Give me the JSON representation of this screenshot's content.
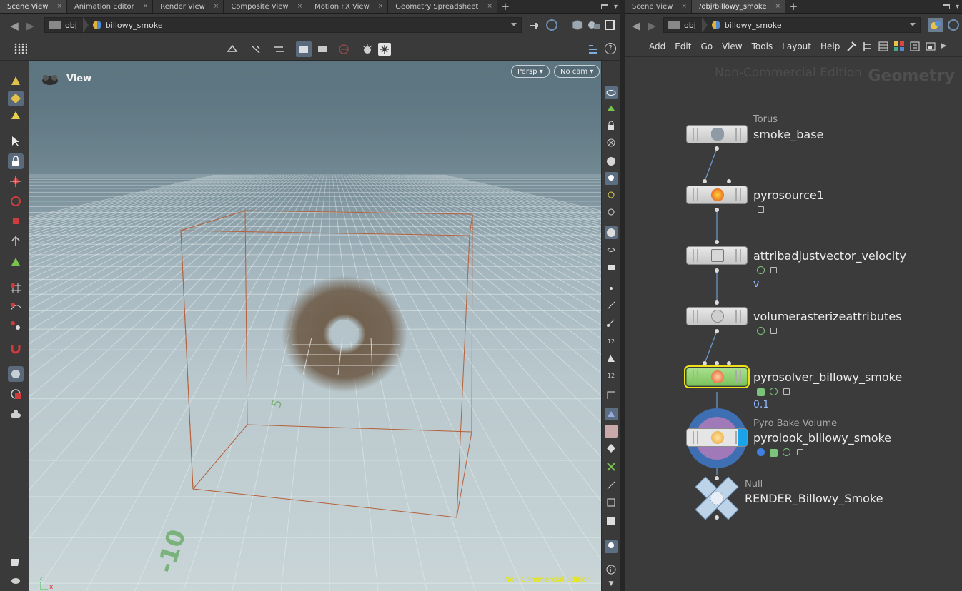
{
  "left_tabs": [
    "Scene View",
    "Animation Editor",
    "Render View",
    "Composite View",
    "Motion FX View",
    "Geometry Spreadsheet"
  ],
  "right_tabs": [
    "Scene View",
    "/obj/billowy_smoke"
  ],
  "left_path": {
    "root": "obj",
    "node": "billowy_smoke"
  },
  "right_path": {
    "root": "obj",
    "node": "billowy_smoke"
  },
  "viewport": {
    "title": "View",
    "persp_btn": "Persp",
    "cam_btn": "No cam",
    "watermark": "Non-Commercial Edition",
    "grid_label_5": "5",
    "grid_label_neg10": "-10",
    "axis_x": "x",
    "axis_z": "z"
  },
  "menu": [
    "Add",
    "Edit",
    "Go",
    "View",
    "Tools",
    "Layout",
    "Help"
  ],
  "network": {
    "watermark": "Non-Commercial Edition",
    "context": "Geometry",
    "nodes": [
      {
        "type": "Torus",
        "name": "smoke_base"
      },
      {
        "type": "",
        "name": "pyrosource1"
      },
      {
        "type": "",
        "name": "attribadjustvector_velocity",
        "sub": "v"
      },
      {
        "type": "",
        "name": "volumerasterizeattributes"
      },
      {
        "type": "",
        "name": "pyrosolver_billowy_smoke",
        "sub": "0.1"
      },
      {
        "type": "Pyro Bake Volume",
        "name": "pyrolook_billowy_smoke"
      },
      {
        "type": "Null",
        "name": "RENDER_Billowy_Smoke"
      }
    ]
  },
  "colors": {
    "selection_outline": "#f0e01a",
    "solver_node": "#8fd36f",
    "bounding_box": "#b5603a",
    "smoke": "#6e5c48",
    "watermark_yellow": "#e6e600"
  }
}
